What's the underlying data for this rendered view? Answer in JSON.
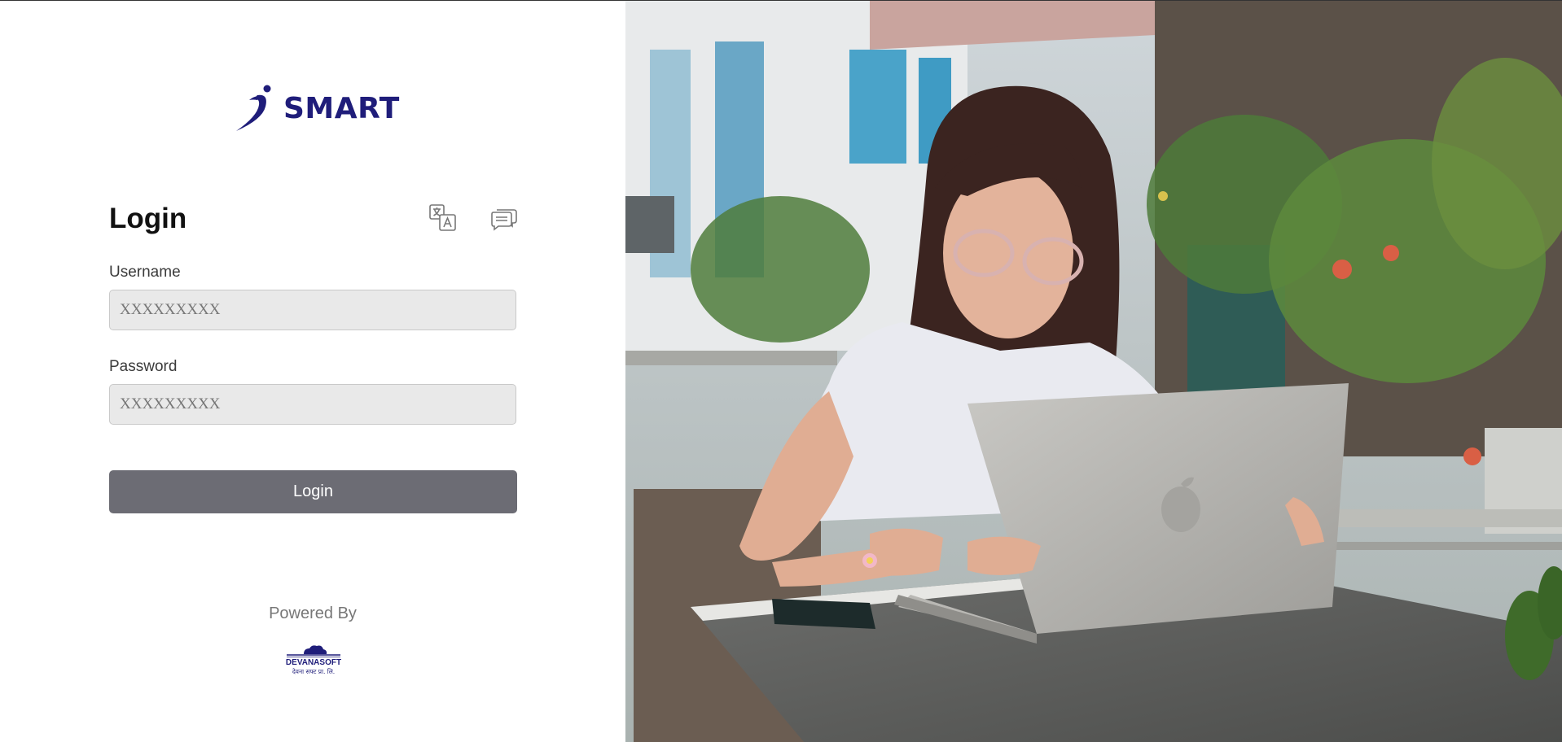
{
  "brand": {
    "name": "SMART"
  },
  "login": {
    "title": "Login",
    "username_label": "Username",
    "username_placeholder": "XXXXXXXXX",
    "password_label": "Password",
    "password_placeholder": "XXXXXXXXX",
    "submit_label": "Login"
  },
  "icons": {
    "language": "translate-icon",
    "feedback": "chat-icon"
  },
  "footer": {
    "powered_by": "Powered By",
    "company_name": "DEVANASOFT",
    "company_subtitle": "देवना सफ्ट प्रा. लि."
  },
  "colors": {
    "brand": "#1f1d7a",
    "button": "#6c6c74",
    "input_bg": "#e9e9e9"
  }
}
